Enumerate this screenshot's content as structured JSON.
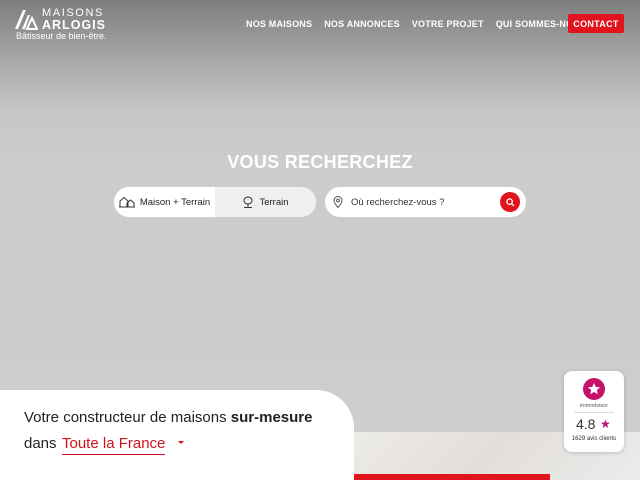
{
  "header": {
    "logo_word1": "MAISONS",
    "logo_word2": "ARLOGIS",
    "logo_tagline": "Bâtisseur de bien-être.",
    "nav": [
      {
        "label": "NOS MAISONS"
      },
      {
        "label": "NOS ANNONCES"
      },
      {
        "label": "VOTRE PROJET"
      },
      {
        "label": "QUI SOMMES-NOUS"
      }
    ],
    "contact_label": "CONTACT"
  },
  "search": {
    "title": "VOUS RECHERCHEZ",
    "options": [
      {
        "label": "Maison + Terrain",
        "icon": "house-icon",
        "selected": true
      },
      {
        "label": "Terrain",
        "icon": "tree-icon",
        "selected": false
      }
    ],
    "location_placeholder": "Où recherchez-vous ?"
  },
  "intro": {
    "tagline_prefix": "Votre constructeur de maisons ",
    "tagline_bold": "sur-mesure",
    "dans": "dans",
    "region": "Toute la France"
  },
  "reviews": {
    "provider": "immodvisor",
    "score": "4.8",
    "star": "★",
    "count": "1629 avis clients"
  },
  "colors": {
    "accent": "#e1141e",
    "badge": "#c4126a"
  }
}
